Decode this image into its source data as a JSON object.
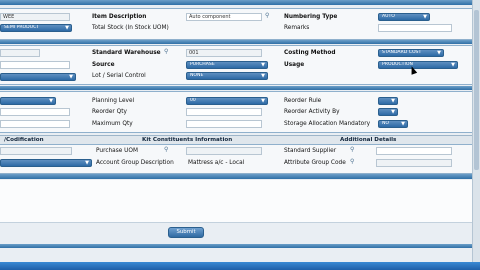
{
  "row1": {
    "left_value_1": "WEE",
    "left_select_1": "SEMI PRODUCT",
    "item_description_label": "Item Description",
    "item_description_value": "Auto component",
    "total_stock_label": "Total Stock (In Stock UOM)",
    "numbering_type_label": "Numbering Type",
    "numbering_type_value": "AUTO",
    "remarks_label": "Remarks"
  },
  "row2": {
    "standard_warehouse_label": "Standard Warehouse",
    "standard_warehouse_value": "001",
    "source_label": "Source",
    "source_value": "PURCHASE",
    "lot_serial_label": "Lot / Serial Control",
    "lot_serial_value": "NONE",
    "costing_method_label": "Costing Method",
    "costing_method_value": "STANDARD COST",
    "usage_label": "Usage",
    "usage_value": "PRODUCTION"
  },
  "row3": {
    "planning_level_label": "Planning Level",
    "planning_level_value": "00",
    "reorder_qty_label": "Reorder Qty",
    "maximum_qty_label": "Maximum Qty",
    "reorder_rule_label": "Reorder Rule",
    "reorder_activity_label": "Reorder Activity By",
    "storage_allocation_label": "Storage Allocation Mandatory",
    "storage_allocation_value": "NO"
  },
  "tabs": {
    "codification": "/Codification",
    "kit": "Kit Constituents Information",
    "additional": "Additional Details"
  },
  "details": {
    "purchase_uom_label": "Purchase UOM",
    "account_group_label": "Account Group Description",
    "account_group_value": "Mattress a/c - Local",
    "standard_supplier_label": "Standard Supplier",
    "attribute_group_label": "Attribute Group Code"
  },
  "submit_label": "Submit",
  "colors": {
    "header": "#2f6fa6",
    "select": "#2d6aa6",
    "taskbar": "#1f5fa8"
  }
}
